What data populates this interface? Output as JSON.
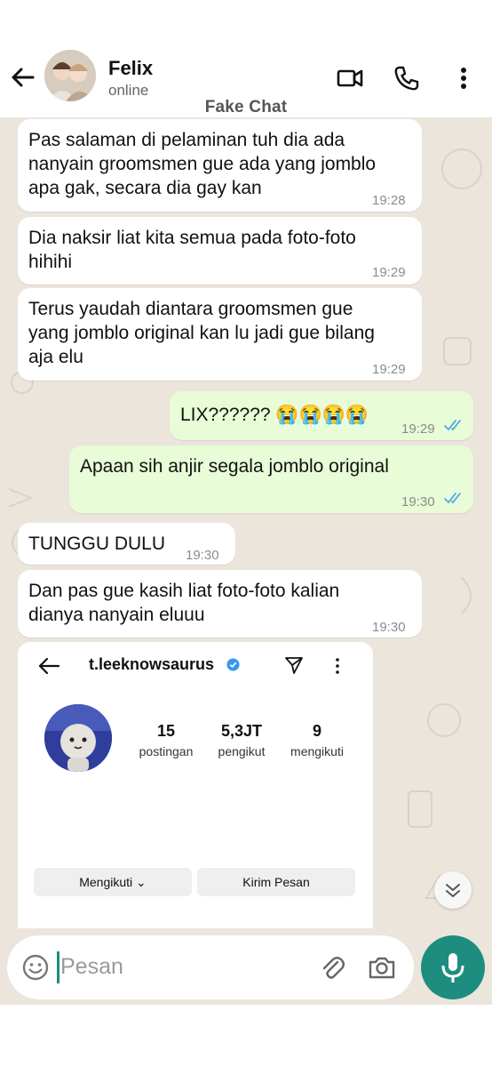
{
  "header": {
    "contact_name": "Felix",
    "status": "online",
    "label": "Fake Chat",
    "icons": [
      "back-arrow-icon",
      "video-call-icon",
      "phone-icon",
      "more-vertical-icon"
    ]
  },
  "messages": [
    {
      "direction": "in",
      "lines": [
        "Pas salaman di pelaminan tuh dia ada",
        "nanyain groomsmen gue ada yang jomblo",
        "apa gak, secara dia gay kan"
      ],
      "time": "19:28"
    },
    {
      "direction": "in",
      "lines": [
        "Dia naksir liat kita semua pada foto-foto",
        "hihihi"
      ],
      "time": "19:29"
    },
    {
      "direction": "in",
      "lines": [
        "Terus yaudah diantara groomsmen gue",
        "yang jomblo original kan lu jadi gue bilang",
        "aja elu"
      ],
      "time": "19:29"
    },
    {
      "direction": "out",
      "text": "LIX?????? 😭😭😭😭",
      "time": "19:29",
      "read": true
    },
    {
      "direction": "out",
      "text": "Apaan sih anjir segala jomblo original",
      "time": "19:30",
      "read": true
    },
    {
      "direction": "in",
      "text": "TUNGGU DULU",
      "time": "19:30"
    },
    {
      "direction": "in",
      "lines": [
        "Dan pas gue kasih liat foto-foto kalian",
        "dianya nanyain eluuu"
      ],
      "time": "19:30"
    }
  ],
  "instagram_card": {
    "handle": "t.leeknowsaurus",
    "stats": [
      {
        "value": "15",
        "label": "postingan"
      },
      {
        "value": "5,3JT",
        "label": "pengikut"
      },
      {
        "value": "9",
        "label": "mengikuti"
      }
    ],
    "follow_button": "Mengikuti ⌄",
    "message_button": "Kirim Pesan"
  },
  "input": {
    "placeholder": "Pesan"
  },
  "colors": {
    "accent": "#1d8d7f",
    "outgoing_bubble": "#e7fcd7",
    "chat_background": "#ece5dc",
    "read_ticks": "#4fa9e6"
  }
}
